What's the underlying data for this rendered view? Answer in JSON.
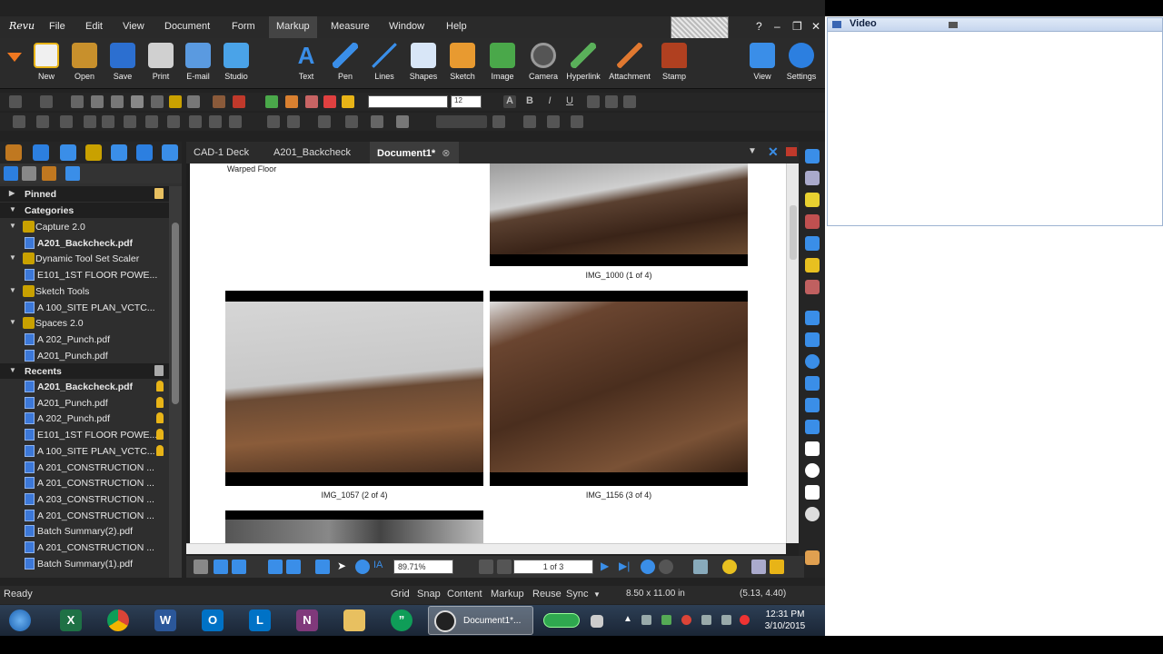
{
  "app": {
    "logo": "Revu",
    "menu": [
      "File",
      "Edit",
      "View",
      "Document",
      "Form",
      "Markup",
      "Measure",
      "Window",
      "Help"
    ],
    "active_menu": "Markup"
  },
  "ribbon": {
    "left": [
      "New",
      "Open",
      "Save",
      "Print",
      "E-mail",
      "Studio"
    ],
    "markup": [
      "Text",
      "Pen",
      "Lines",
      "Shapes",
      "Sketch",
      "Image",
      "Camera",
      "Hyperlink",
      "Attachment",
      "Stamp"
    ],
    "right": [
      "View",
      "Settings"
    ]
  },
  "toolbar": {
    "font_size": "12"
  },
  "left_panel": {
    "pinned": "Pinned",
    "categories": "Categories",
    "tree": [
      {
        "type": "group",
        "label": "Capture 2.0"
      },
      {
        "type": "file",
        "label": "A201_Backcheck.pdf",
        "bold": true
      },
      {
        "type": "group",
        "label": "Dynamic Tool Set Scaler"
      },
      {
        "type": "file",
        "label": "E101_1ST FLOOR POWE..."
      },
      {
        "type": "group",
        "label": "Sketch Tools"
      },
      {
        "type": "file",
        "label": "A 100_SITE PLAN_VCTC..."
      },
      {
        "type": "group",
        "label": "Spaces 2.0"
      },
      {
        "type": "file",
        "label": "A 202_Punch.pdf"
      },
      {
        "type": "file",
        "label": "A201_Punch.pdf"
      }
    ],
    "recents": "Recents",
    "recent_items": [
      {
        "label": "A201_Backcheck.pdf",
        "bold": true,
        "pinned": true
      },
      {
        "label": "A201_Punch.pdf",
        "pinned": true
      },
      {
        "label": "A 202_Punch.pdf",
        "pinned": true
      },
      {
        "label": "E101_1ST FLOOR POWE...",
        "pinned": true
      },
      {
        "label": "A 100_SITE PLAN_VCTC...",
        "pinned": true
      },
      {
        "label": "A 201_CONSTRUCTION ..."
      },
      {
        "label": "A 201_CONSTRUCTION ..."
      },
      {
        "label": "A 203_CONSTRUCTION ..."
      },
      {
        "label": "A 201_CONSTRUCTION ..."
      },
      {
        "label": "Batch Summary(2).pdf"
      },
      {
        "label": "A 201_CONSTRUCTION ..."
      },
      {
        "label": "Batch Summary(1).pdf"
      }
    ]
  },
  "tabs": [
    "CAD-1 Deck",
    "A201_Backcheck",
    "Document1*"
  ],
  "document": {
    "heading": "Warped Floor",
    "captions": [
      "IMG_1000 (1 of 4)",
      "IMG_1057 (2 of 4)",
      "IMG_1156 (3 of 4)"
    ]
  },
  "navigation": {
    "zoom": "89.71%",
    "page": "1 of 3"
  },
  "status": {
    "ready": "Ready",
    "items": [
      "Grid",
      "Snap",
      "Content",
      "Markup",
      "Reuse",
      "Sync"
    ],
    "page_size": "8.50 x 11.00 in",
    "coords": "(5.13, 4.40)"
  },
  "video_window": {
    "title": "Video"
  },
  "taskbar": {
    "active_label": "Document1*...",
    "time": "12:31 PM",
    "date": "3/10/2015"
  },
  "colors": {
    "accent": "#3c78d8",
    "pin": "#e8b417",
    "dark": "#2b2b2b"
  }
}
